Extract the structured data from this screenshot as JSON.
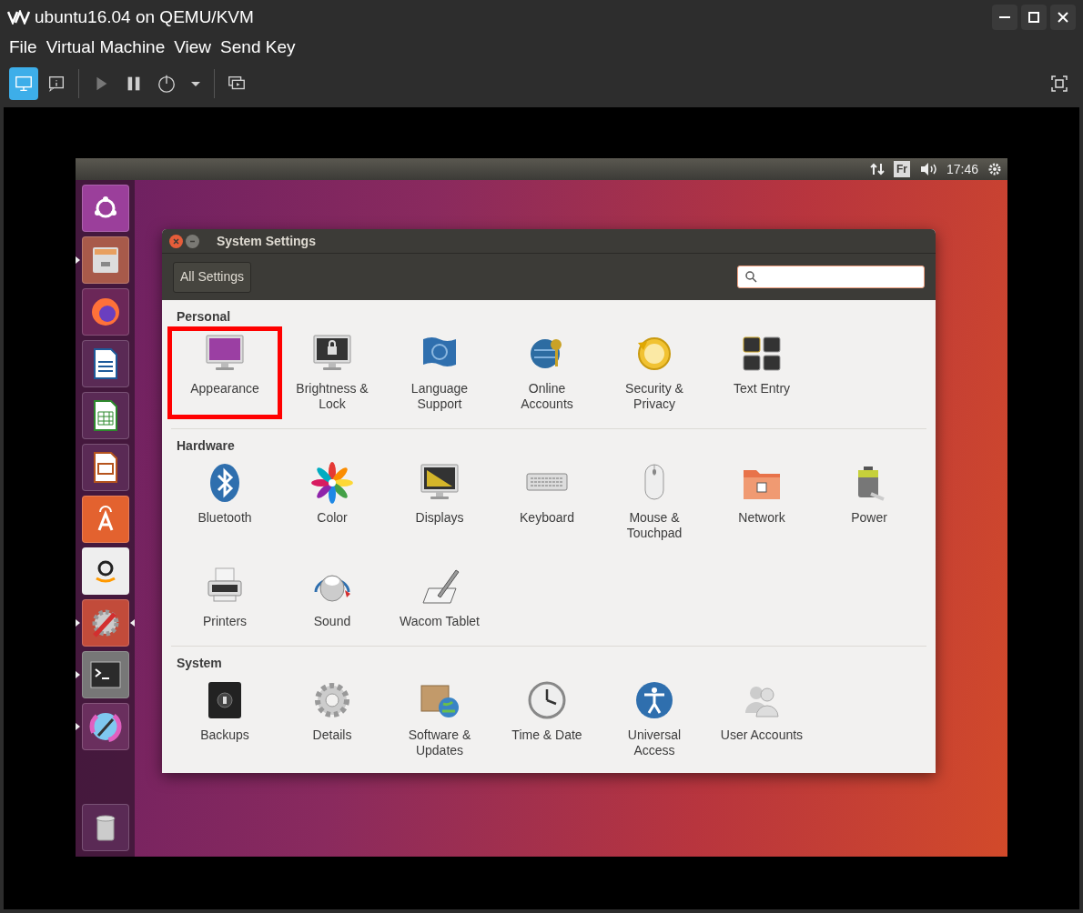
{
  "window": {
    "title": "ubuntu16.04 on QEMU/KVM"
  },
  "menu": [
    "File",
    "Virtual Machine",
    "View",
    "Send Key"
  ],
  "toolbar": [
    {
      "kind": "console",
      "selected": true
    },
    {
      "kind": "details",
      "selected": false
    },
    {
      "kind": "run",
      "selected": false
    },
    {
      "kind": "pause",
      "selected": false
    },
    {
      "kind": "power",
      "selected": false
    },
    {
      "kind": "dropdown",
      "selected": false
    },
    {
      "kind": "screens",
      "selected": false
    }
  ],
  "top_panel": {
    "keyboard_layout": "Fr",
    "clock": "17:46"
  },
  "launcher": [
    {
      "kind": "dash",
      "running": false,
      "focused": false
    },
    {
      "kind": "files",
      "running": true,
      "focused": false
    },
    {
      "kind": "firefox",
      "running": false,
      "focused": false
    },
    {
      "kind": "writer",
      "running": false,
      "focused": false
    },
    {
      "kind": "calc",
      "running": false,
      "focused": false
    },
    {
      "kind": "impress",
      "running": false,
      "focused": false
    },
    {
      "kind": "store",
      "running": false,
      "focused": false
    },
    {
      "kind": "amazon",
      "running": false,
      "focused": false
    },
    {
      "kind": "settings",
      "running": true,
      "focused": true
    },
    {
      "kind": "terminal",
      "running": true,
      "focused": false
    },
    {
      "kind": "color-picker",
      "running": true,
      "focused": false
    },
    {
      "kind": "trash",
      "running": false,
      "focused": false
    }
  ],
  "settings_window": {
    "title": "System Settings",
    "all_settings_button": "All Settings",
    "sections": [
      {
        "heading": "Personal",
        "items": [
          {
            "kind": "appearance",
            "label": "Appearance",
            "highlighted": true
          },
          {
            "kind": "brightness",
            "label": "Brightness & Lock",
            "highlighted": false
          },
          {
            "kind": "language",
            "label": "Language Support",
            "highlighted": false
          },
          {
            "kind": "online",
            "label": "Online Accounts",
            "highlighted": false
          },
          {
            "kind": "security",
            "label": "Security & Privacy",
            "highlighted": false
          },
          {
            "kind": "text-entry",
            "label": "Text Entry",
            "highlighted": false
          }
        ]
      },
      {
        "heading": "Hardware",
        "items": [
          {
            "kind": "bluetooth",
            "label": "Bluetooth",
            "highlighted": false
          },
          {
            "kind": "color",
            "label": "Color",
            "highlighted": false
          },
          {
            "kind": "displays",
            "label": "Displays",
            "highlighted": false
          },
          {
            "kind": "keyboard",
            "label": "Keyboard",
            "highlighted": false
          },
          {
            "kind": "mouse",
            "label": "Mouse & Touchpad",
            "highlighted": false
          },
          {
            "kind": "network",
            "label": "Network",
            "highlighted": false
          },
          {
            "kind": "power",
            "label": "Power",
            "highlighted": false
          },
          {
            "kind": "printers",
            "label": "Printers",
            "highlighted": false
          },
          {
            "kind": "sound",
            "label": "Sound",
            "highlighted": false
          },
          {
            "kind": "wacom",
            "label": "Wacom Tablet",
            "highlighted": false
          }
        ]
      },
      {
        "heading": "System",
        "items": [
          {
            "kind": "backups",
            "label": "Backups",
            "highlighted": false
          },
          {
            "kind": "details",
            "label": "Details",
            "highlighted": false
          },
          {
            "kind": "software",
            "label": "Software & Updates",
            "highlighted": false
          },
          {
            "kind": "time",
            "label": "Time & Date",
            "highlighted": false
          },
          {
            "kind": "universal-access",
            "label": "Universal Access",
            "highlighted": false
          },
          {
            "kind": "users",
            "label": "User Accounts",
            "highlighted": false
          }
        ]
      }
    ]
  }
}
